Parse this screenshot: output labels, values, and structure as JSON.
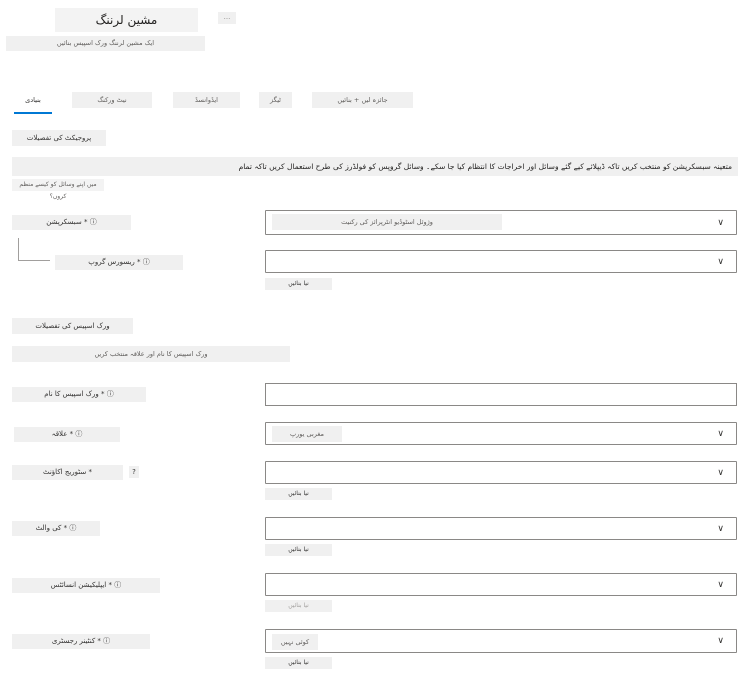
{
  "header": {
    "title": "مشین لرننگ",
    "more_label": "...",
    "subtitle": "ایک مشین لرننگ ورک اسپیس بنائیں"
  },
  "tabs": [
    {
      "label": "بنیادی",
      "active": true
    },
    {
      "label": "نیٹ ورکنگ",
      "active": false
    },
    {
      "label": "ایڈوانسڈ",
      "active": false
    },
    {
      "label": "ٹیگز",
      "active": false
    },
    {
      "label": "جائزہ لیں + بنائیں",
      "active": false
    }
  ],
  "project": {
    "section_title": "پروجیکٹ کی تفصیلات",
    "description": "متعینہ سبسکرپشن کو منتخب کریں تاکہ ڈیپلائے کیے گئے وسائل اور اخراجات کا انتظام کیا جا سکے۔ وسائل گروپس کو فولڈرز کی طرح استعمال کریں تاکہ تمام",
    "learn_more": "میں اپنے وسائل کو کیسے منظم کروں؟",
    "subscription_label": "سبسکرپشن * ⓘ",
    "subscription_value": "وژوئل اسٹوڈیو انٹرپرائز کی رکنیت",
    "resource_group_label": "ریسورس گروپ * ⓘ",
    "resource_group_create": "نیا بنائیں"
  },
  "workspace": {
    "section_title": "ورک اسپیس کی تفصیلات",
    "description": "ورک اسپیس کا نام اور علاقہ منتخب کریں",
    "name_label": "ورک اسپیس کا نام * ⓘ",
    "region_label": "علاقہ * ⓘ",
    "region_value": "مغربی یورپ",
    "storage_label": "سٹوریج اکاؤنٹ *",
    "storage_info": "?",
    "storage_create": "نیا بنائیں",
    "keyvault_label": "کی والٹ * ⓘ",
    "keyvault_create": "نیا بنائیں",
    "appinsights_label": "ایپلیکیشن انسائٹس * ⓘ",
    "appinsights_create": "نیا بنائیں",
    "registry_label": "کنٹینر رجسٹری * ⓘ",
    "registry_value": "کوئی نہیں",
    "registry_create": "نیا بنائیں"
  },
  "icons": {
    "chevron": "chevron-down-icon"
  }
}
